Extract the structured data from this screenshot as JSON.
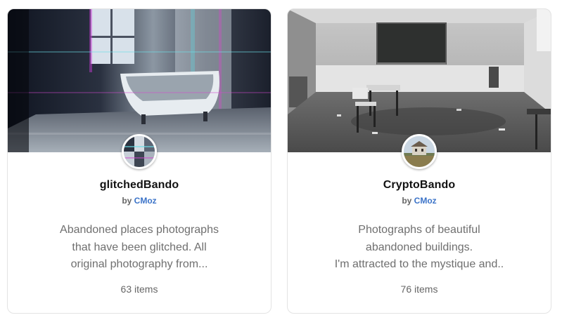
{
  "collections": [
    {
      "title": "glitchedBando",
      "by_prefix": "by",
      "author": "CMoz",
      "description_lines": [
        "Abandoned places photographs",
        "that have been glitched. All",
        "original photography from..."
      ],
      "item_count": "63 items",
      "banner_image": "glitched-abandoned-bathroom-photo",
      "avatar_image": "glitched-collage-avatar"
    },
    {
      "title": "CryptoBando",
      "by_prefix": "by",
      "author": "CMoz",
      "description_lines": [
        "Photographs of beautiful",
        "abandoned buildings.",
        "I'm attracted to the mystique and.."
      ],
      "item_count": "76 items",
      "banner_image": "abandoned-classroom-photo",
      "avatar_image": "abandoned-house-field-avatar"
    }
  ],
  "colors": {
    "title": "#111111",
    "author_link": "#3b73c8",
    "muted_text": "#6f6f6f",
    "card_border": "#e3e3e3"
  }
}
